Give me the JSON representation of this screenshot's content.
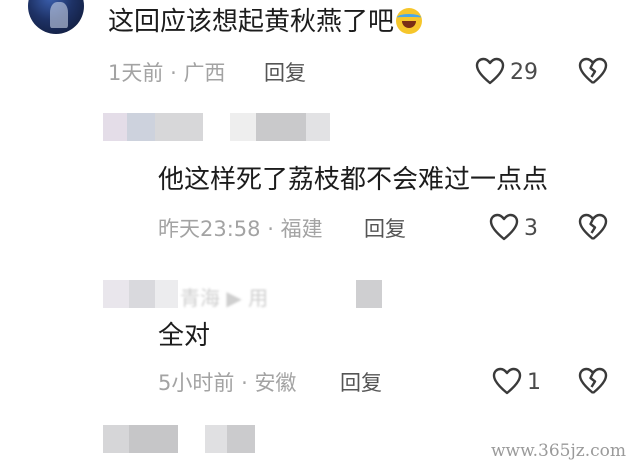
{
  "comments": [
    {
      "text": "这回应该想起黄秋燕了吧",
      "emoji": "laughing-crying-emoji",
      "time": "1天前",
      "location": "广西",
      "reply_label": "回复",
      "likes": "29"
    },
    {
      "text": "他这样死了荔枝都不会难过一点点",
      "time": "昨天23:58",
      "location": "福建",
      "reply_label": "回复",
      "likes": "3"
    },
    {
      "text": "全对",
      "time": "5小时前",
      "location": "安徽",
      "reply_label": "回复",
      "likes": "1"
    }
  ],
  "separator": "·",
  "reply_to_blurred": "青海 ▶ 用",
  "watermark": "www.365jz.com",
  "icons": [
    "heart-icon",
    "broken-heart-icon"
  ]
}
